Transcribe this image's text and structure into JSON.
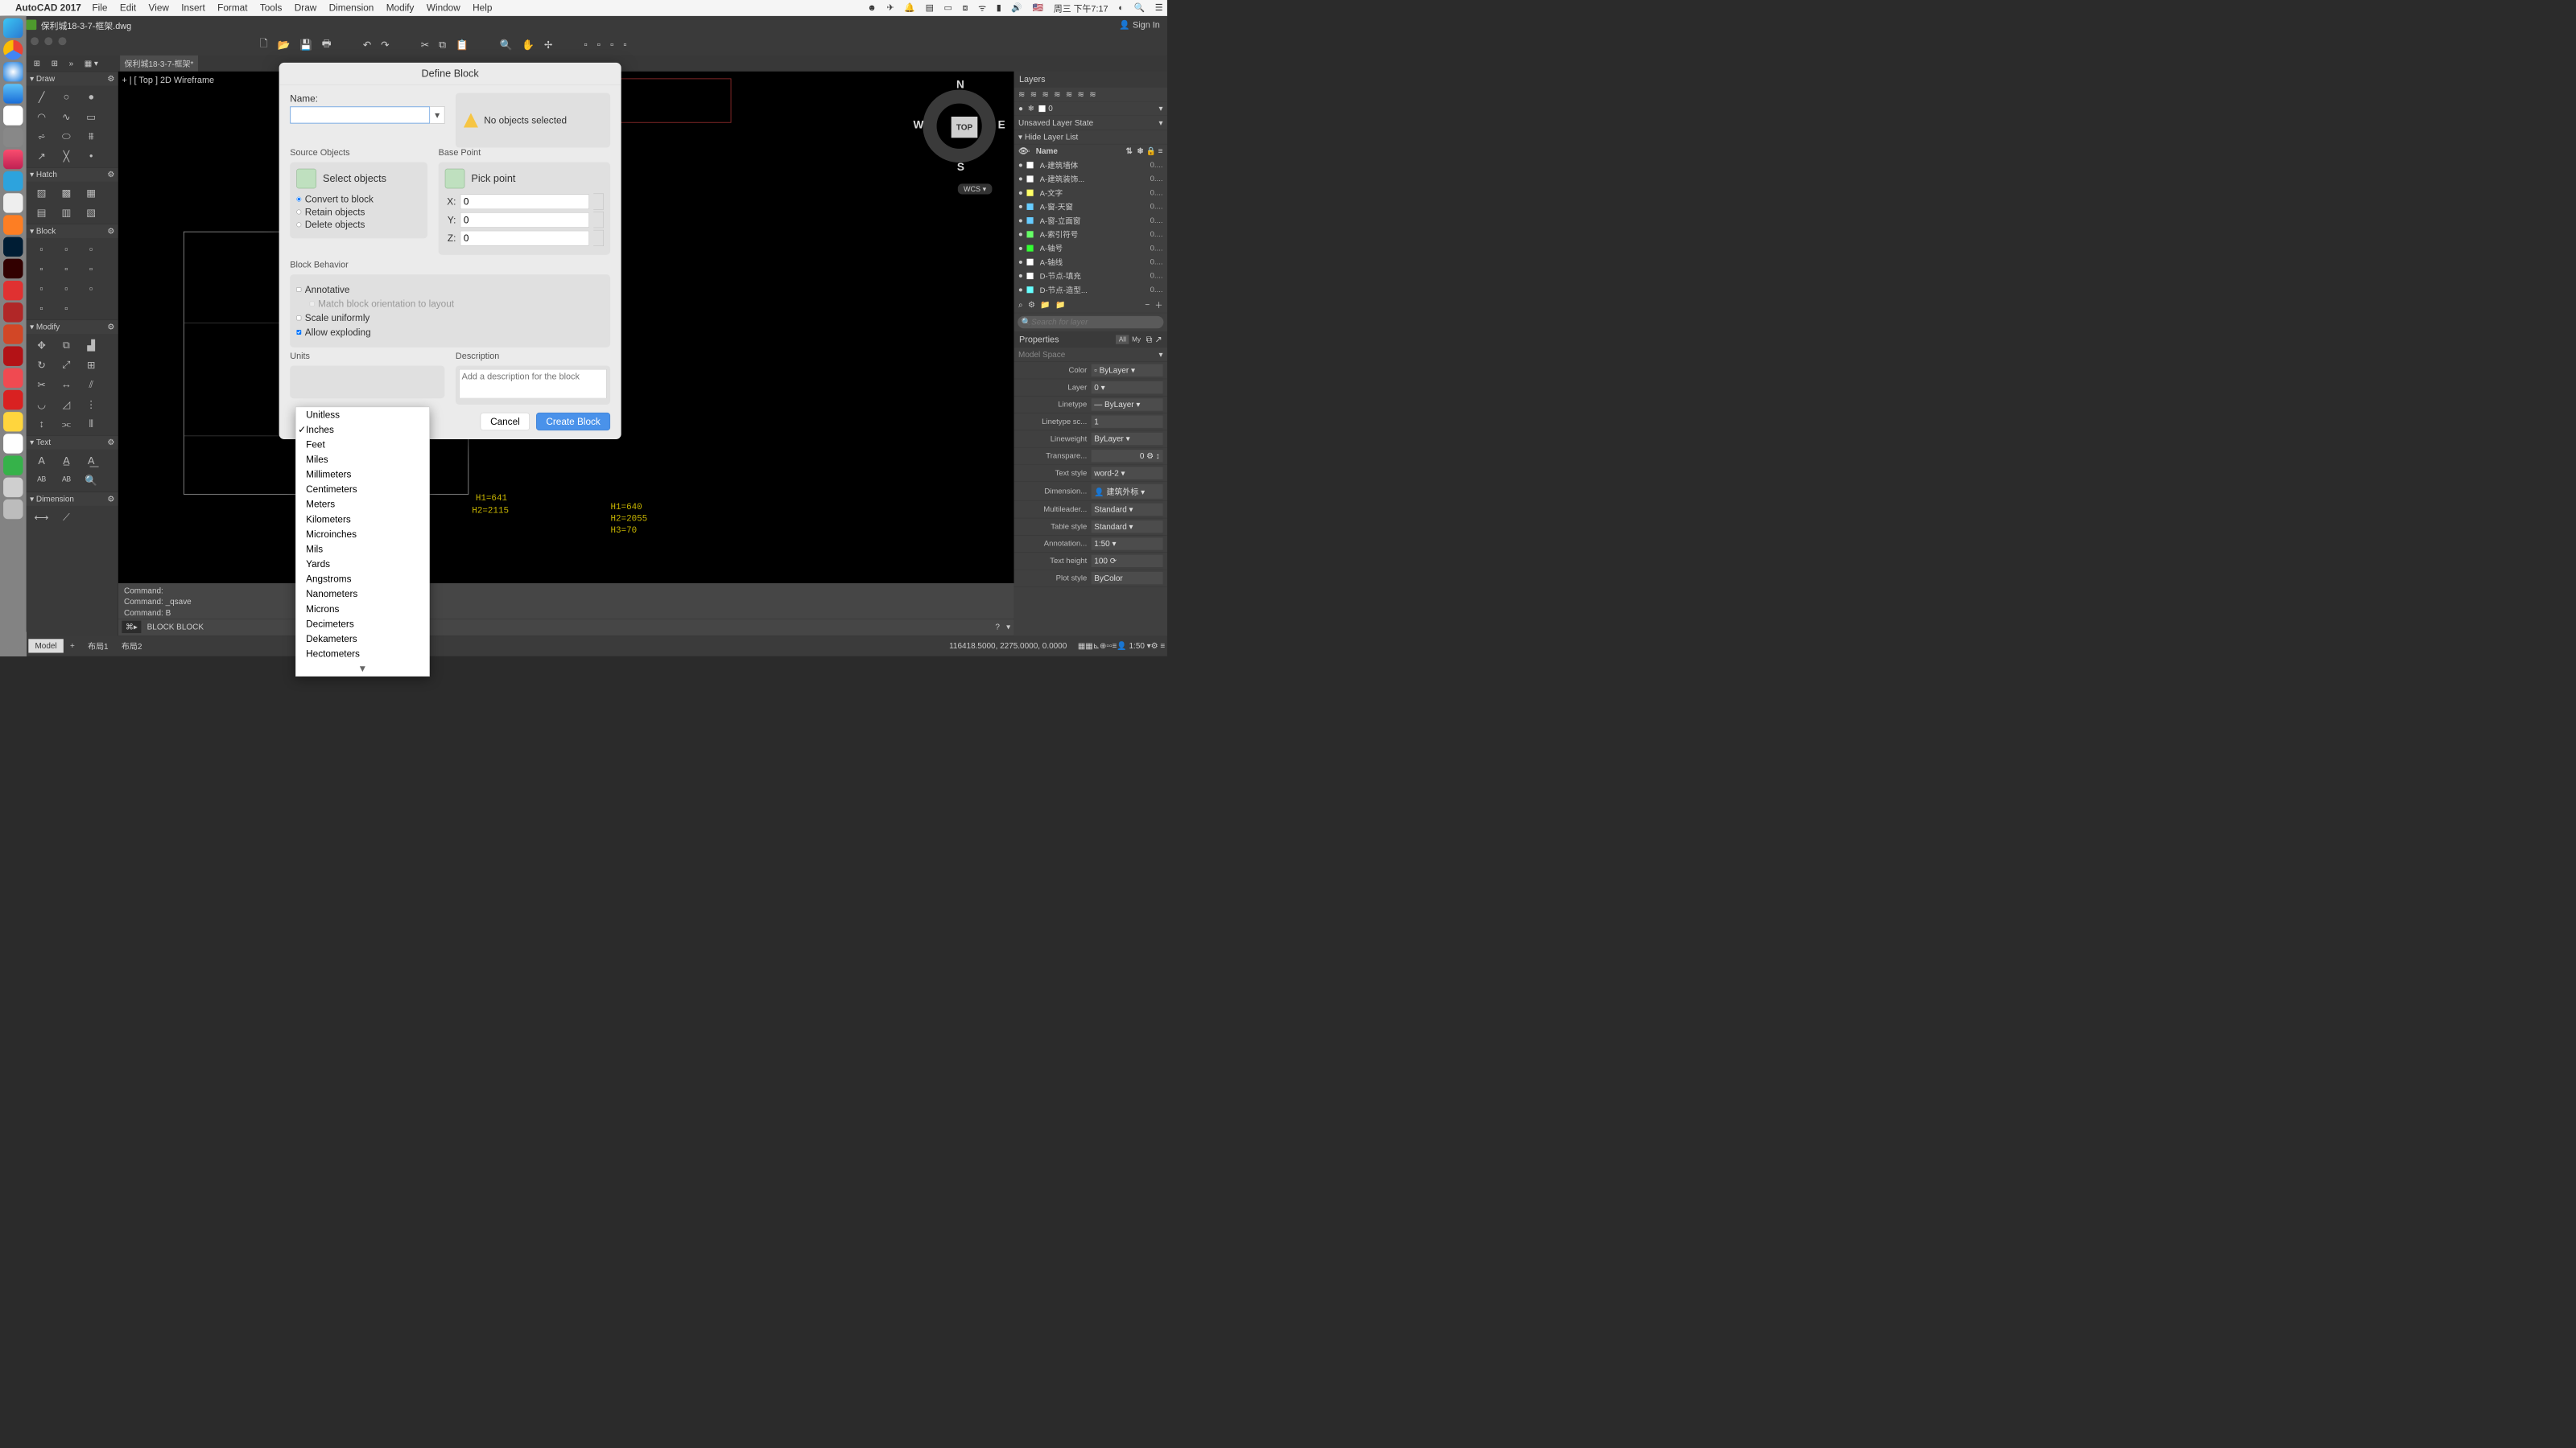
{
  "menubar": {
    "app": "AutoCAD 2017",
    "items": [
      "File",
      "Edit",
      "View",
      "Insert",
      "Format",
      "Tools",
      "Draw",
      "Dimension",
      "Modify",
      "Window",
      "Help"
    ],
    "clock": "周三 下午7:17"
  },
  "window": {
    "title": "保利城18-3-7-框架.dwg",
    "signin": "Sign In"
  },
  "tabstrip": {
    "tab": "保利城18-3-7-框架*"
  },
  "viewctrl": "[ Top ] 2D Wireframe",
  "navcube": {
    "top": "TOP",
    "n": "N",
    "e": "E",
    "s": "S",
    "w": "W"
  },
  "wcs": "WCS",
  "palettes": {
    "draw": "Draw",
    "hatch": "Hatch",
    "block": "Block",
    "modify": "Modify",
    "text": "Text",
    "dimension": "Dimension"
  },
  "cmd": {
    "hist": [
      "Command:",
      "Command: _qsave",
      "Command: B"
    ],
    "prompt": "⌘▸",
    "line": "BLOCK BLOCK"
  },
  "anno1": "H1=641",
  "anno2": "H2=2115",
  "anno3": "H1=640",
  "anno4": "H2=2055",
  "anno5": "H3=70",
  "status": {
    "tabs": [
      "Model",
      "布局1",
      "布局2"
    ],
    "coord": "116418.5000, 2275.0000, 0.0000",
    "scale": "1:50"
  },
  "dialog": {
    "title": "Define Block",
    "name_label": "Name:",
    "warn": "No objects selected",
    "source_objects": "Source Objects",
    "select_objects": "Select objects",
    "convert": "Convert to block",
    "retain": "Retain objects",
    "delete": "Delete objects",
    "basepoint": "Base Point",
    "pick": "Pick point",
    "x": "X:",
    "y": "Y:",
    "z": "Z:",
    "xv": "0",
    "yv": "0",
    "zv": "0",
    "behavior": "Block Behavior",
    "annotative": "Annotative",
    "match": "Match block orientation to layout",
    "scale": "Scale uniformly",
    "explode": "Allow exploding",
    "units": "Units",
    "description": "Description",
    "desc_placeholder": "Add a description for the block",
    "cancel": "Cancel",
    "create": "Create Block"
  },
  "units_menu": [
    "Unitless",
    "Inches",
    "Feet",
    "Miles",
    "Millimeters",
    "Centimeters",
    "Meters",
    "Kilometers",
    "Microinches",
    "Mils",
    "Yards",
    "Angstroms",
    "Nanometers",
    "Microns",
    "Decimeters",
    "Dekameters",
    "Hectometers"
  ],
  "units_selected": "Inches",
  "layers": {
    "panel": "Layers",
    "state": "Unsaved Layer State",
    "hide": "Hide Layer List",
    "zero": "0",
    "name": "Name",
    "items": [
      {
        "color": "#ffffff",
        "name": "A-建筑墙体",
        "st": "0...."
      },
      {
        "color": "#ffffff",
        "name": "A-建筑装饰...",
        "st": "0...."
      },
      {
        "color": "#ffff66",
        "name": "A-文字",
        "st": "0...."
      },
      {
        "color": "#66ccff",
        "name": "A-窗-天窗",
        "st": "0...."
      },
      {
        "color": "#66ccff",
        "name": "A-窗-立面窗",
        "st": "0...."
      },
      {
        "color": "#66ff66",
        "name": "A-索引符号",
        "st": "0...."
      },
      {
        "color": "#33ff33",
        "name": "A-轴号",
        "st": "0...."
      },
      {
        "color": "#ffffff",
        "name": "A-轴线",
        "st": "0...."
      },
      {
        "color": "#ffffff",
        "name": "D-节点-填充",
        "st": "0...."
      },
      {
        "color": "#66ffff",
        "name": "D-节点-造型...",
        "st": "0...."
      }
    ],
    "search": "Search for layer"
  },
  "props": {
    "panel": "Properties",
    "all": "All",
    "my": "My",
    "model": "Model Space",
    "color_k": "Color",
    "color_v": "ByLayer",
    "layer_k": "Layer",
    "layer_v": "0",
    "ltype_k": "Linetype",
    "ltype_v": "ByLayer",
    "ltsc_k": "Linetype sc...",
    "ltsc_v": "1",
    "lw_k": "Lineweight",
    "lw_v": "ByLayer",
    "tr_k": "Transpare...",
    "tr_v": "0",
    "ts_k": "Text style",
    "ts_v": "word-2",
    "dim_k": "Dimension...",
    "dim_v": "建筑外标",
    "ml_k": "Multileader...",
    "ml_v": "Standard",
    "tbl_k": "Table style",
    "tbl_v": "Standard",
    "ann_k": "Annotation...",
    "ann_v": "1:50",
    "th_k": "Text height",
    "th_v": "100",
    "ps_k": "Plot style",
    "ps_v": "ByColor"
  }
}
